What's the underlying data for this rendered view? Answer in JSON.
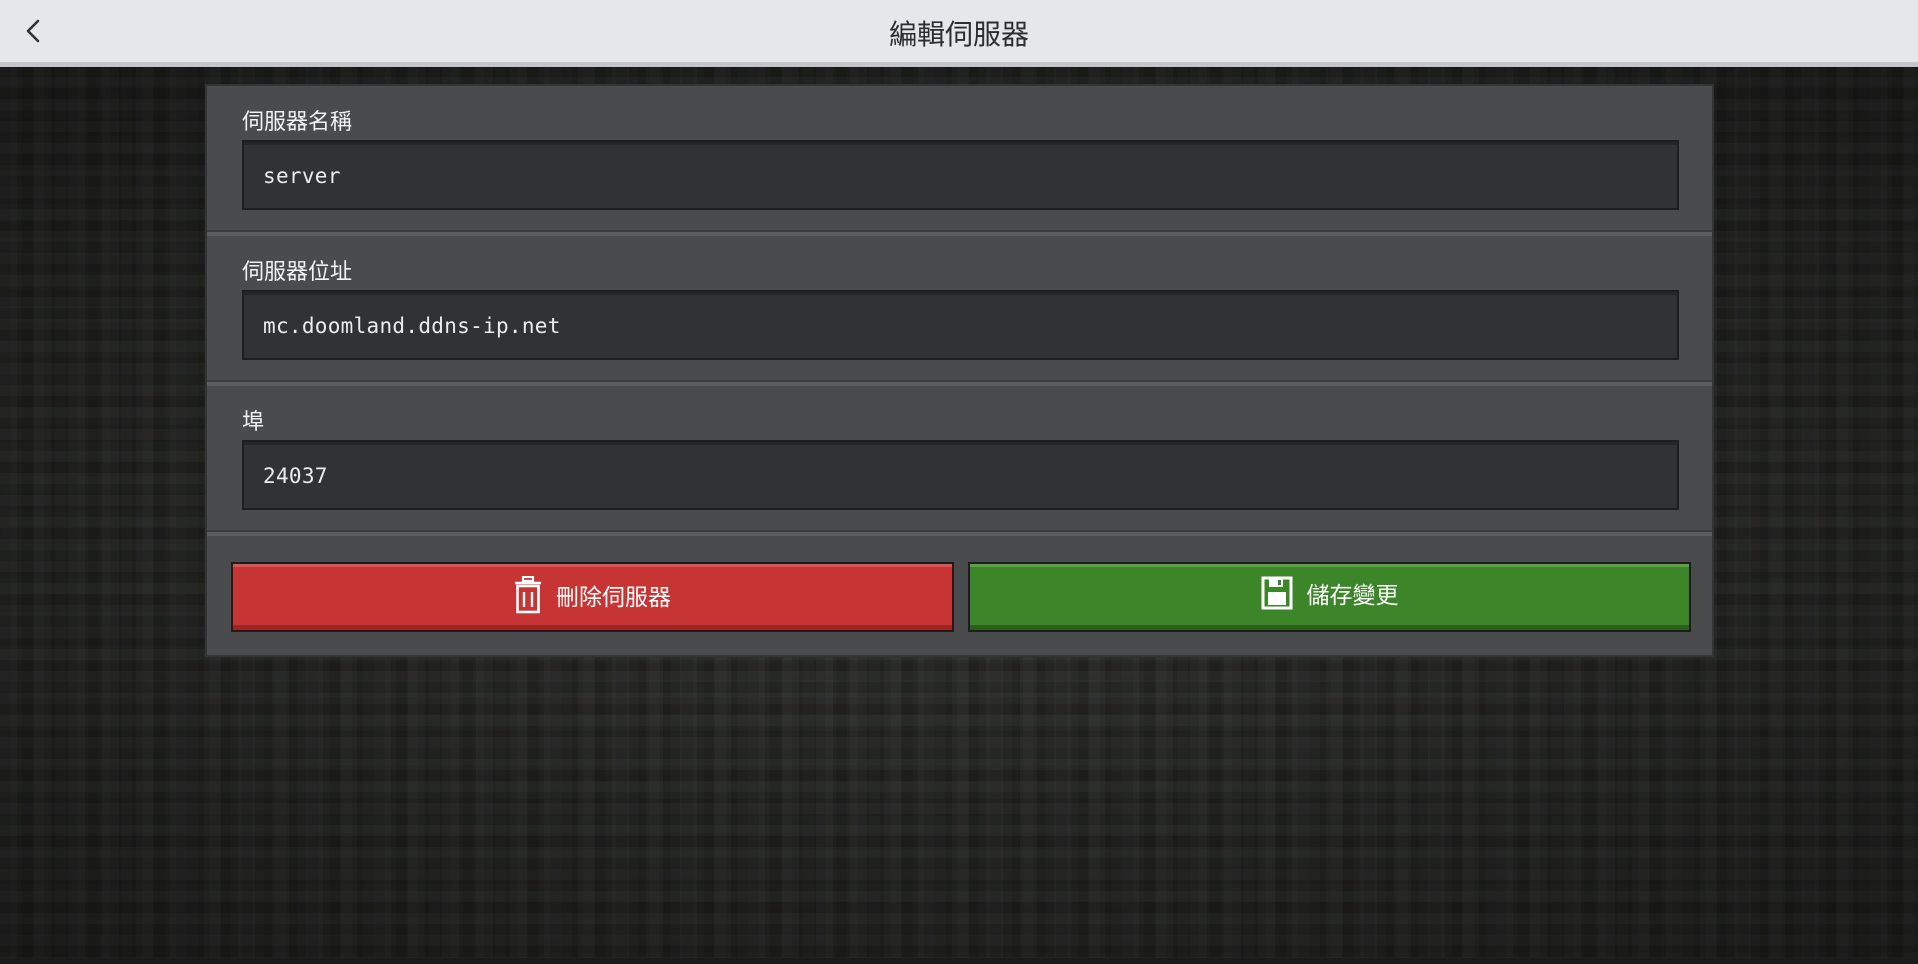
{
  "header": {
    "title": "編輯伺服器",
    "back_icon": "chevron-left-icon"
  },
  "form": {
    "server_name": {
      "label": "伺服器名稱",
      "value": "server"
    },
    "server_address": {
      "label": "伺服器位址",
      "value": "mc.doomland.ddns-ip.net"
    },
    "port": {
      "label": "埠",
      "value": "24037"
    }
  },
  "buttons": {
    "delete": {
      "label": "刪除伺服器",
      "icon": "trash-icon",
      "color": "#c63433"
    },
    "save": {
      "label": "儲存變更",
      "icon": "save-icon",
      "color": "#3c8528"
    }
  }
}
